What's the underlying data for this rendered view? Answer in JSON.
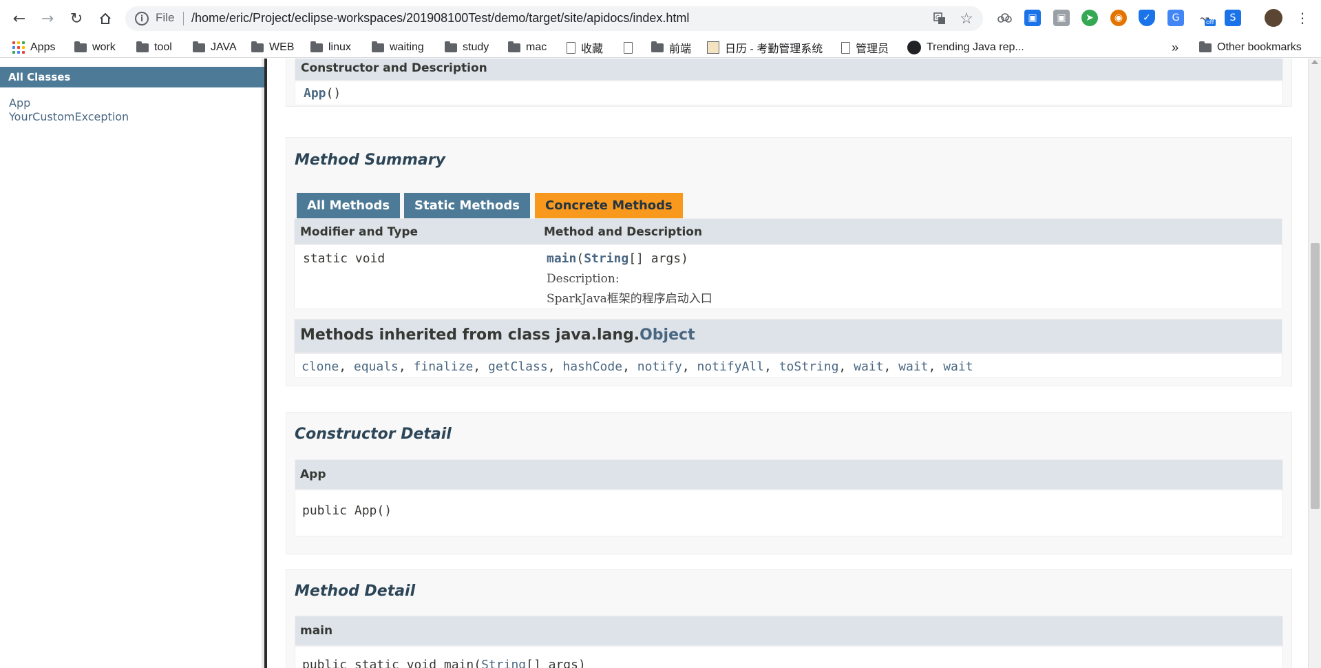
{
  "browser": {
    "file_label": "File",
    "url": "/home/eric/Project/eclipse-workspaces/201908100Test/demo/target/site/apidocs/index.html",
    "extension_badge": "off"
  },
  "bookmarks": {
    "apps": "Apps",
    "items": [
      "work",
      "tool",
      "JAVA",
      "WEB",
      "linux",
      "waiting",
      "study",
      "mac",
      "收藏",
      "",
      "前端",
      "日历 - 考勤管理系统",
      "管理员",
      "Trending Java rep..."
    ],
    "overflow": "»",
    "other": "Other bookmarks"
  },
  "left_frame": {
    "header": "All Classes",
    "classes": [
      "App",
      "YourCustomException"
    ]
  },
  "constructor_summary": {
    "header": "Constructor and Description",
    "entry_name": "App",
    "entry_parens": "()"
  },
  "method_summary": {
    "title": "Method Summary",
    "tabs": [
      "All Methods",
      "Static Methods",
      "Concrete Methods"
    ],
    "col1": "Modifier and Type",
    "col2": "Method and Description",
    "row": {
      "modifier": "static void",
      "method_name": "main",
      "param_type": "String",
      "param_rest": "[] args)",
      "open_paren": "(",
      "desc_label": "Description:",
      "desc_text": "SparkJava框架的程序启动入口"
    },
    "inherited_prefix": "Methods inherited from class java.lang.",
    "inherited_class": "Object",
    "inherited_methods": [
      "clone",
      "equals",
      "finalize",
      "getClass",
      "hashCode",
      "notify",
      "notifyAll",
      "toString",
      "wait",
      "wait",
      "wait"
    ],
    "separator": ", "
  },
  "constructor_detail": {
    "title": "Constructor Detail",
    "header": "App",
    "signature": "public App()"
  },
  "method_detail": {
    "title": "Method Detail",
    "header": "main",
    "sig_prefix": "public static void main(",
    "sig_type": "String",
    "sig_suffix": "[] args)"
  }
}
